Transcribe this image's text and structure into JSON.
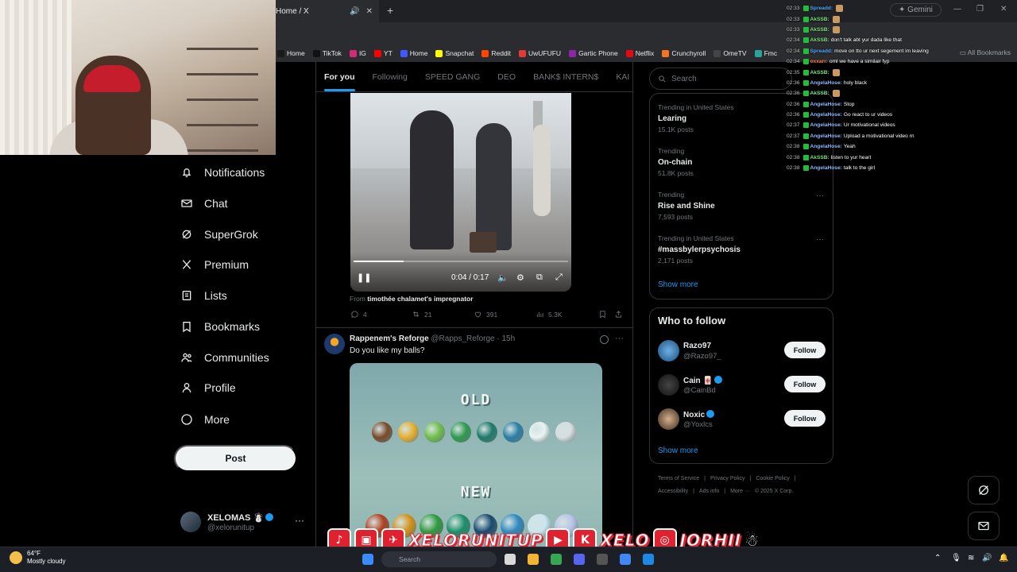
{
  "browser": {
    "tab_title": "Home / X",
    "new_tab": "+",
    "gemini": "Gemini",
    "bookmarks": [
      {
        "label": "Home",
        "color": "#1a1a1a"
      },
      {
        "label": "TikTok",
        "color": "#111111"
      },
      {
        "label": "IG",
        "color": "#d62976"
      },
      {
        "label": "YT",
        "color": "#ff0000"
      },
      {
        "label": "Home",
        "color": "#3d5afe"
      },
      {
        "label": "Snapchat",
        "color": "#fffc00"
      },
      {
        "label": "Reddit",
        "color": "#ff4500"
      },
      {
        "label": "UwUFUFU",
        "color": "#e53935"
      },
      {
        "label": "Gartic Phone",
        "color": "#8e24aa"
      },
      {
        "label": "Netflix",
        "color": "#e50914"
      },
      {
        "label": "Crunchyroll",
        "color": "#f47521"
      },
      {
        "label": "OmeTV",
        "color": "#444444"
      },
      {
        "label": "Fmc",
        "color": "#26a69a"
      }
    ],
    "all_bookmarks": "All Bookmarks"
  },
  "nav": {
    "items": [
      {
        "label": "Notifications",
        "icon": "bell-icon"
      },
      {
        "label": "Chat",
        "icon": "mail-icon"
      },
      {
        "label": "SuperGrok",
        "icon": "grok-icon"
      },
      {
        "label": "Premium",
        "icon": "x-logo-icon"
      },
      {
        "label": "Lists",
        "icon": "list-icon"
      },
      {
        "label": "Bookmarks",
        "icon": "bookmark-icon"
      },
      {
        "label": "Communities",
        "icon": "people-icon"
      },
      {
        "label": "Profile",
        "icon": "person-icon"
      },
      {
        "label": "More",
        "icon": "more-circle-icon"
      }
    ],
    "post_label": "Post",
    "account": {
      "name": "XELOMAS ☃️",
      "handle": "@xelorunitup",
      "more": "···"
    }
  },
  "feed": {
    "tabs": [
      "For you",
      "Following",
      "SPEED GANG",
      "DEO",
      "BANK$ INTERN$",
      "KAI MA"
    ],
    "video": {
      "time": "0:04 / 0:17",
      "progress": 0.235,
      "from_prefix": "From",
      "from_name": "timothée chalamet's impregnator",
      "replies": "4",
      "reposts": "21",
      "likes": "391",
      "views": "5.3K"
    },
    "tweet": {
      "name": "Rappenem's Reforge",
      "handle": "@Rapps_Reforge",
      "time": "· 15h",
      "text": "Do you like my balls?",
      "menu": "···",
      "image_old": "OLD",
      "image_new": "NEW"
    }
  },
  "right": {
    "search_placeholder": "Search",
    "trends": [
      {
        "context": "Trending in United States",
        "name": "Learing",
        "count": "15.1K posts"
      },
      {
        "context": "Trending",
        "name": "On-chain",
        "count": "51.8K posts"
      },
      {
        "context": "Trending",
        "name": "Rise and Shine",
        "count": "7,593 posts"
      },
      {
        "context": "Trending in United States",
        "name": "#massbylerpsychosis",
        "count": "2,171 posts"
      }
    ],
    "trend_menu": "···",
    "show_more": "Show more",
    "who_to_follow": "Who to follow",
    "follow_label": "Follow",
    "accounts": [
      {
        "name": "Razo97",
        "handle": "@Razo97_",
        "verified": false
      },
      {
        "name": "Cain 🀄",
        "handle": "@CainBd",
        "verified": true
      },
      {
        "name": "Noxic",
        "handle": "@Yoxlcs",
        "verified": true
      }
    ],
    "footer_line1": [
      "Terms of Service",
      "|",
      "Privacy Policy",
      "|",
      "Cookie Policy",
      "|"
    ],
    "footer_line2": [
      "Accessibility",
      "|",
      "Ads info",
      "|",
      "More ···",
      "© 2025 X Corp."
    ]
  },
  "chat": [
    {
      "time": "02:33",
      "user": "Spreadd:",
      "color": "#4aa8ff",
      "msg": ""
    },
    {
      "time": "02:33",
      "user": "AkSSB:",
      "color": "#7ce07c",
      "msg": ""
    },
    {
      "time": "02:33",
      "user": "AkSSB:",
      "color": "#7ce07c",
      "msg": ""
    },
    {
      "time": "02:34",
      "user": "AkSSB:",
      "color": "#7ce07c",
      "msg": "don't talk abt yur dada like that"
    },
    {
      "time": "02:34",
      "user": "Spreadd:",
      "color": "#4aa8ff",
      "msg": "move on tto ur next segement im leaving"
    },
    {
      "time": "02:34",
      "user": "oxxarr:",
      "color": "#ff7a59",
      "msg": "oml we have a similair fyp"
    },
    {
      "time": "02:35",
      "user": "AkSSB:",
      "color": "#7ce07c",
      "msg": ""
    },
    {
      "time": "02:36",
      "user": "AngelaHose:",
      "color": "#8fb8ff",
      "msg": "holy black"
    },
    {
      "time": "02:36",
      "user": "AkSSB:",
      "color": "#7ce07c",
      "msg": ""
    },
    {
      "time": "02:36",
      "user": "AngelaHose:",
      "color": "#8fb8ff",
      "msg": "Stop"
    },
    {
      "time": "02:36",
      "user": "AngelaHose:",
      "color": "#8fb8ff",
      "msg": "Go react to ur videos"
    },
    {
      "time": "02:37",
      "user": "AngelaHose:",
      "color": "#8fb8ff",
      "msg": "Ur motivational videos"
    },
    {
      "time": "02:37",
      "user": "AngelaHose:",
      "color": "#8fb8ff",
      "msg": "Upload a motivational video rn"
    },
    {
      "time": "02:38",
      "user": "AngelaHose:",
      "color": "#8fb8ff",
      "msg": "Yeah"
    },
    {
      "time": "02:38",
      "user": "AkSSB:",
      "color": "#7ce07c",
      "msg": "listen to yur heart"
    },
    {
      "time": "02:38",
      "user": "AngelaHose:",
      "color": "#8fb8ff",
      "msg": "talk to the girl"
    }
  ],
  "banner": {
    "handle1": "XELORUNITUP",
    "handle2": "XELO",
    "handle3": "JORHII"
  },
  "taskbar": {
    "temp": "64°F",
    "weather": "Mostly cloudy",
    "search": "Search"
  }
}
